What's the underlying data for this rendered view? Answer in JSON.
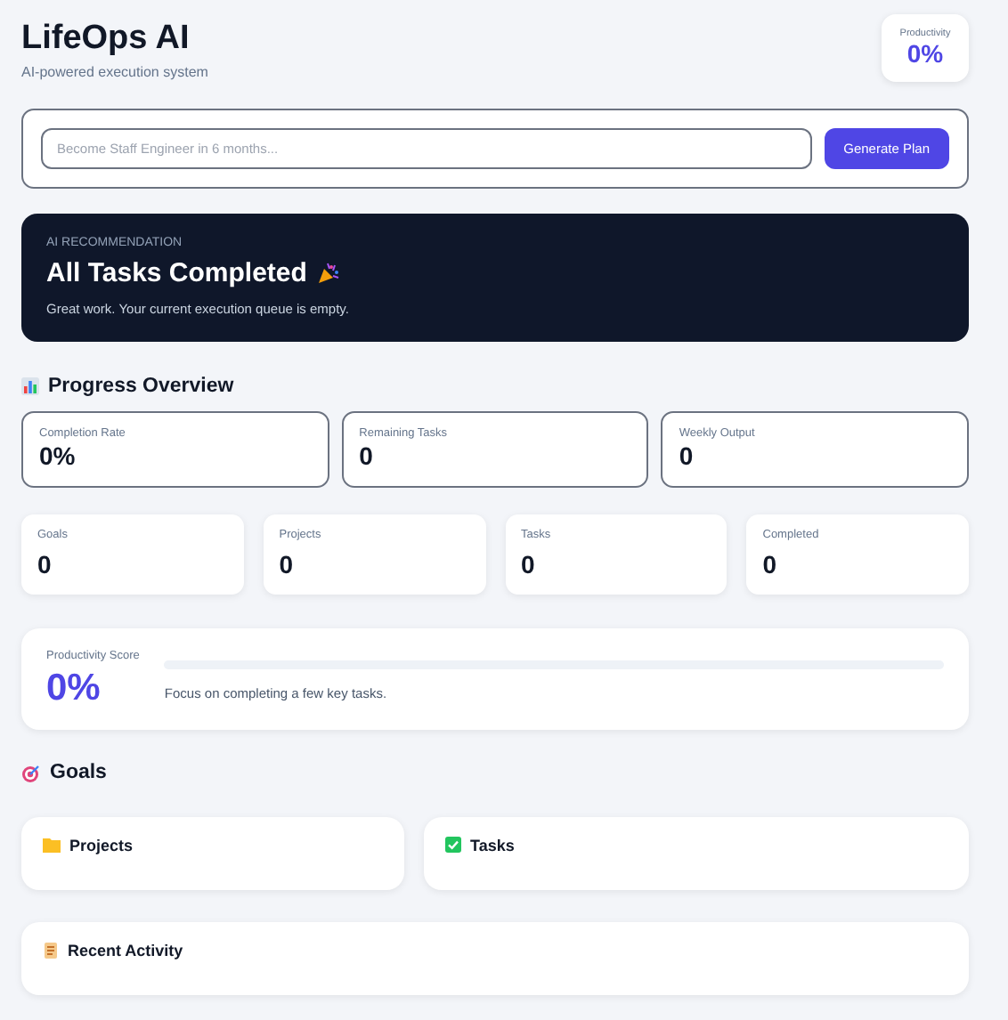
{
  "header": {
    "title": "LifeOps AI",
    "subtitle": "AI-powered execution system",
    "badge": {
      "label": "Productivity",
      "value": "0%"
    }
  },
  "plan_form": {
    "placeholder": "Become Staff Engineer in 6 months...",
    "button": "Generate Plan"
  },
  "recommendation": {
    "eyebrow": "AI RECOMMENDATION",
    "title": "All Tasks Completed",
    "message": "Great work. Your current execution queue is empty."
  },
  "progress": {
    "heading": "Progress Overview",
    "primary_stats": [
      {
        "label": "Completion Rate",
        "value": "0%"
      },
      {
        "label": "Remaining Tasks",
        "value": "0"
      },
      {
        "label": "Weekly Output",
        "value": "0"
      }
    ],
    "counts": [
      {
        "label": "Goals",
        "value": "0"
      },
      {
        "label": "Projects",
        "value": "0"
      },
      {
        "label": "Tasks",
        "value": "0"
      },
      {
        "label": "Completed",
        "value": "0"
      }
    ],
    "score": {
      "label": "Productivity Score",
      "value": "0%",
      "level": 0,
      "message": "Focus on completing a few key tasks."
    }
  },
  "goals": {
    "heading": "Goals"
  },
  "panels": [
    {
      "kind": "projects",
      "title": "Projects"
    },
    {
      "kind": "tasks",
      "title": "Tasks"
    }
  ],
  "activity": {
    "kind": "activity",
    "title": "Recent Activity"
  }
}
